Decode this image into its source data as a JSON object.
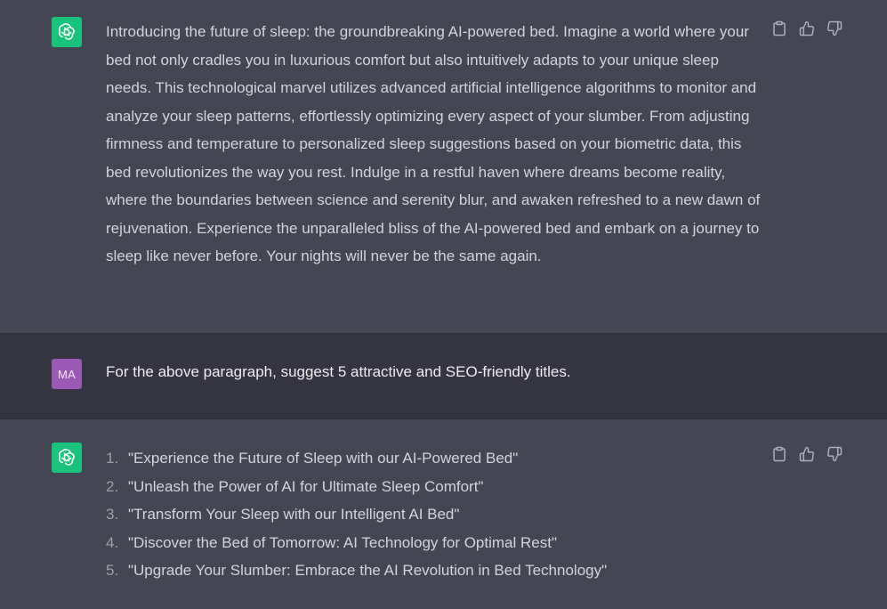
{
  "messages": {
    "first": {
      "role": "assistant",
      "avatar_icon": "openai-logo-icon",
      "text": "Introducing the future of sleep: the groundbreaking AI-powered bed. Imagine a world where your bed not only cradles you in luxurious comfort but also intuitively adapts to your unique sleep needs. This technological marvel utilizes advanced artificial intelligence algorithms to monitor and analyze your sleep patterns, effortlessly optimizing every aspect of your slumber. From adjusting firmness and temperature to personalized sleep suggestions based on your biometric data, this bed revolutionizes the way you rest. Indulge in a restful haven where dreams become reality, where the boundaries between science and serenity blur, and awaken refreshed to a new dawn of rejuvenation. Experience the unparalleled bliss of the AI-powered bed and embark on a journey to sleep like never before. Your nights will never be the same again."
    },
    "second": {
      "role": "user",
      "avatar_initials": "MA",
      "text": "For the above paragraph, suggest 5 attractive and SEO-friendly titles."
    },
    "third": {
      "role": "assistant",
      "avatar_icon": "openai-logo-icon",
      "items": [
        {
          "num": "1.",
          "text": "\"Experience the Future of Sleep with our AI-Powered Bed\""
        },
        {
          "num": "2.",
          "text": "\"Unleash the Power of AI for Ultimate Sleep Comfort\""
        },
        {
          "num": "3.",
          "text": "\"Transform Your Sleep with our Intelligent AI Bed\""
        },
        {
          "num": "4.",
          "text": "\"Discover the Bed of Tomorrow: AI Technology for Optimal Rest\""
        },
        {
          "num": "5.",
          "text": "\"Upgrade Your Slumber: Embrace the AI Revolution in Bed Technology\""
        }
      ]
    }
  },
  "actions": [
    "clipboard-icon",
    "thumbs-up-icon",
    "thumbs-down-icon"
  ],
  "colors": {
    "assistant_bg": "#444654",
    "user_bg": "#343541",
    "bot_avatar": "#19c37d",
    "user_avatar": "#9b59b6",
    "text": "#d1d5db"
  }
}
